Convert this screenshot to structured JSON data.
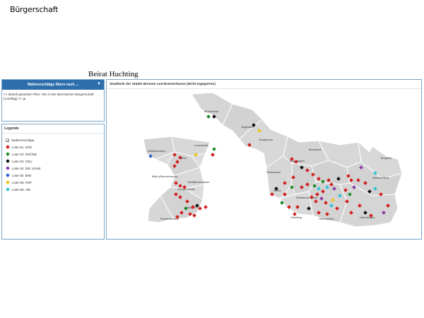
{
  "header": {
    "title": "Bürgerschaft",
    "subtitle": "Beirat Huchting"
  },
  "filter": {
    "button_label": "Wahlvorschläge filtern nach ...",
    "chevron_icon": "chevron-down-icon",
    "active_filter_text": ">> aktuell gesetzter Filter: Sitz in der Bremischen Bürgerschaft (Landtag) >> ja"
  },
  "legend": {
    "title": "Legende",
    "items": [
      {
        "label": "Wahlvorschläge",
        "kind": "checkbox",
        "color": "#999999"
      },
      {
        "label": "Liste 01: SPD",
        "kind": "diamond",
        "color": "#d21f1f"
      },
      {
        "label": "Liste 02: GRÜNE",
        "kind": "diamond",
        "color": "#1f8a2a"
      },
      {
        "label": "Liste 03: CDU",
        "kind": "diamond",
        "color": "#111111"
      },
      {
        "label": "Liste 04: DIE LINKE",
        "kind": "diamond",
        "color": "#8a3aa8"
      },
      {
        "label": "Liste 05: BIW",
        "kind": "diamond",
        "color": "#2a62c9"
      },
      {
        "label": "Liste 06: FDP",
        "kind": "diamond",
        "color": "#f0c419"
      },
      {
        "label": "Liste 09: AfD",
        "kind": "diamond",
        "color": "#35c3d8"
      }
    ]
  },
  "map": {
    "title": "Stadtteile der Städte Bremen und Bremerhaven (Nicht lagegetreu)",
    "district_labels": [
      "Blumenthal",
      "Vegesack",
      "Burglesum",
      "Weddewarden",
      "Lehe",
      "Leherheide",
      "Mitte (Bremerhaven)",
      "Schiffdorferdamm",
      "Geestemünde",
      "Wulsdorf",
      "Fischereihafen",
      "Blockland",
      "Gröpelingen",
      "Seehausen",
      "Strom",
      "Woltmershausen",
      "Huchting",
      "Obervieland",
      "Hemelingen",
      "Oberneuland",
      "Borgfeld"
    ],
    "colors": {
      "header_blue": "#2d6fad",
      "border_blue": "#7aa5c8",
      "land": "#dcdcdc",
      "district_border": "#ffffff"
    }
  }
}
